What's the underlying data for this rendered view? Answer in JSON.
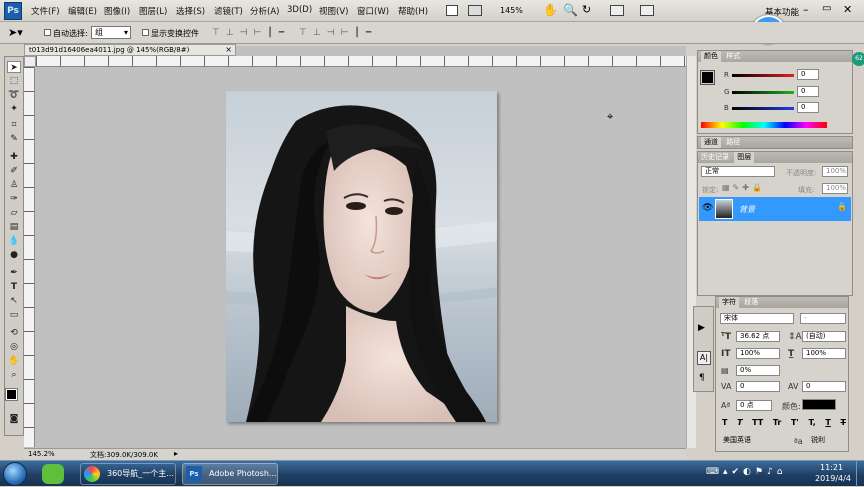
{
  "app": {
    "logo": "Ps",
    "workspace_label": "基本功能",
    "timer_badge": "00:00",
    "side_badge": "62"
  },
  "menus": [
    "文件(F)",
    "编辑(E)",
    "图像(I)",
    "图层(L)",
    "选择(S)",
    "滤镜(T)",
    "分析(A)",
    "3D(D)",
    "视图(V)",
    "窗口(W)",
    "帮助(H)"
  ],
  "zoom_dropdown": "145%",
  "options_bar": {
    "auto_select_label": "自动选择:",
    "auto_select_value": "组",
    "show_transform_label": "显示变换控件"
  },
  "document": {
    "tab_title": "t013d91d16406ea4011.jpg @ 145%(RGB/8#)",
    "zoom_status": "145.2%",
    "doc_size": "文档:309.0K/309.0K"
  },
  "color_panel": {
    "tabs": [
      "颜色",
      "样式"
    ],
    "channels": [
      {
        "label": "R",
        "value": "0",
        "color": "#e02020"
      },
      {
        "label": "G",
        "value": "0",
        "color": "#20b020"
      },
      {
        "label": "B",
        "value": "0",
        "color": "#2040e0"
      }
    ]
  },
  "channels_panel": {
    "tabs": [
      "通道",
      "路径"
    ]
  },
  "layers_panel": {
    "tabs": [
      "历史记录",
      "图层"
    ],
    "blend_mode": "正常",
    "opacity_label": "不透明度:",
    "opacity_value": "100%",
    "lock_label": "锁定:",
    "fill_label": "填充:",
    "fill_value": "100%",
    "layers": [
      {
        "name": "背景",
        "selected": true
      }
    ],
    "selection_color": "#3399ff"
  },
  "character_panel": {
    "tabs": [
      "字符",
      "段落"
    ],
    "font_family": "宋体",
    "font_style": "-",
    "font_size": "36.62 点",
    "leading": "(自动)",
    "vertical_scale": "100%",
    "horizontal_scale": "100%",
    "baseline_percent": "0%",
    "kerning": "0",
    "tracking": "0",
    "baseline_shift": "0 点",
    "color_label": "颜色:",
    "text_color": "#000000",
    "style_buttons": [
      "T",
      "T",
      "TT",
      "Tr",
      "T'",
      "T,",
      "T",
      "T"
    ],
    "language": "美国英语",
    "aa_label": "ªa",
    "antialias": "锐利"
  },
  "taskbar": {
    "buttons": [
      {
        "label": "360导航_一个主..."
      },
      {
        "label": "Adobe Photosh..."
      }
    ],
    "time": "11:21",
    "date": "2019/4/4"
  }
}
